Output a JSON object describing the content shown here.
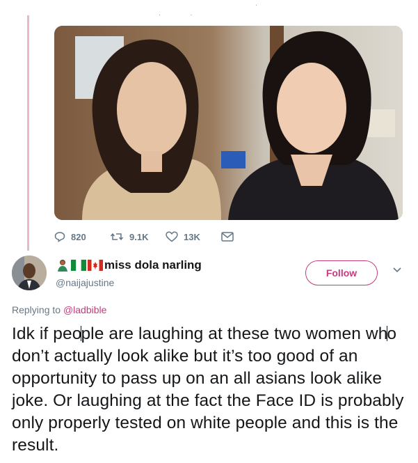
{
  "tweet": {
    "stats": {
      "replies": "820",
      "retweets": "9.1K",
      "likes": "13K"
    },
    "photo_alt": "Two women standing in an office",
    "icons": {
      "reply": "reply-icon",
      "retweet": "retweet-icon",
      "like": "heart-icon",
      "dm": "envelope-icon"
    }
  },
  "reply_tweet": {
    "display_name": "miss dola narling",
    "name_emoji": [
      "woman-emoji",
      "nigeria-flag",
      "canada-flag"
    ],
    "handle": "@naijajustine",
    "follow_label": "Follow",
    "replying_prefix": "Replying to",
    "replying_to": "@ladbible",
    "text_part1": "Idk if peo",
    "text_part2": "ple are laughing at these two women wh",
    "text_part3": "o don’t actually look alike but it’s too good of an opportunity to pass up on an all asians look alike joke. Or laughing at the fact the Face ID is probably only properly tested on white people and this is the result."
  },
  "colors": {
    "accent": "#c53b7e",
    "thread_line": "#e8b7c8",
    "secondary_text": "#657786"
  }
}
